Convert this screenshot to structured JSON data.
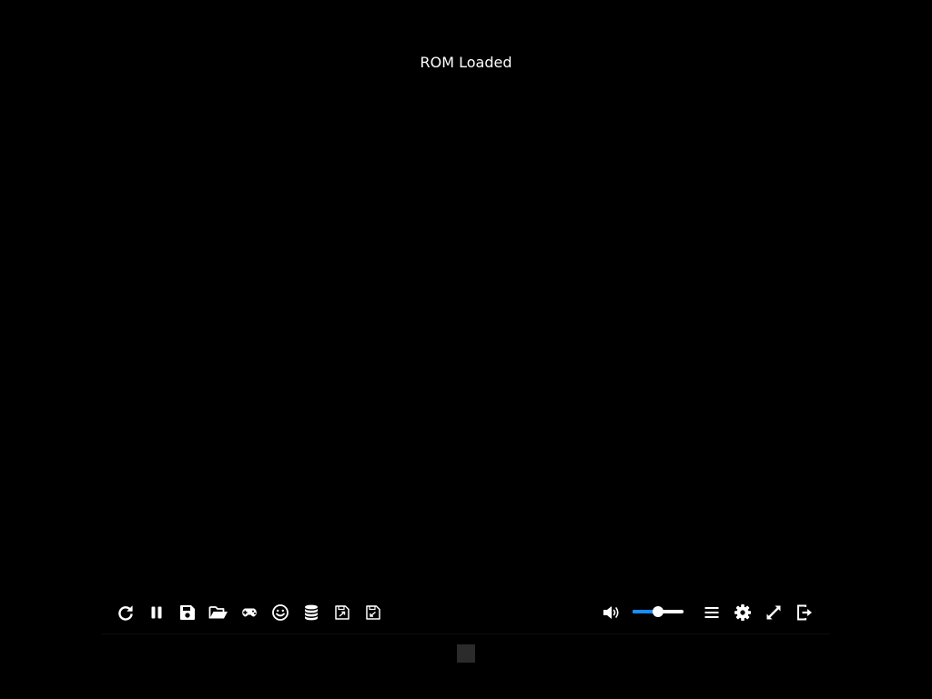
{
  "status": {
    "message": "ROM Loaded"
  },
  "toolbar": {
    "left_buttons": [
      {
        "icon": "restart-icon"
      },
      {
        "icon": "pause-icon"
      },
      {
        "icon": "save-state-icon"
      },
      {
        "icon": "load-state-icon"
      },
      {
        "icon": "gamepad-icon"
      },
      {
        "icon": "cheats-icon"
      },
      {
        "icon": "cache-manager-icon"
      },
      {
        "icon": "export-save-icon"
      },
      {
        "icon": "import-save-icon"
      }
    ],
    "right_buttons": [
      {
        "icon": "context-menu-icon"
      },
      {
        "icon": "settings-icon"
      },
      {
        "icon": "fullscreen-icon"
      },
      {
        "icon": "exit-icon"
      }
    ],
    "volume": {
      "icon": "volume-icon",
      "level": 0.5
    }
  },
  "colors": {
    "background": "#000000",
    "icon": "#ffffff",
    "volume_fill": "#1a8cff",
    "menu_toggle": "#2b2b2b"
  }
}
